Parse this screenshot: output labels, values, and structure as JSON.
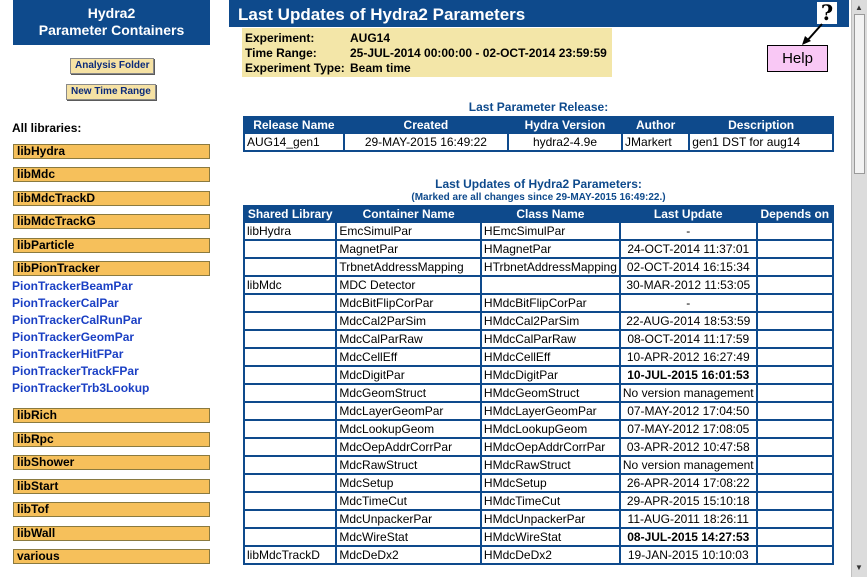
{
  "sidebar": {
    "title_line1": "Hydra2",
    "title_line2": "Parameter Containers",
    "analysis_folder_label": "Analysis Folder",
    "new_time_range_label": "New Time Range",
    "all_libraries_label": "All libraries:",
    "libs_top": [
      "libHydra",
      "libMdc",
      "libMdcTrackD",
      "libMdcTrackG",
      "libParticle",
      "libPionTracker"
    ],
    "pion_tracker_containers": [
      "PionTrackerBeamPar",
      "PionTrackerCalPar",
      "PionTrackerCalRunPar",
      "PionTrackerGeomPar",
      "PionTrackerHitFPar",
      "PionTrackerTrackFPar",
      "PionTrackerTrb3Lookup"
    ],
    "libs_bottom": [
      "libRich",
      "libRpc",
      "libShower",
      "libStart",
      "libTof",
      "libWall",
      "various"
    ]
  },
  "header": {
    "title": "Last Updates of Hydra2 Parameters",
    "help_glyph": "?"
  },
  "help_box": {
    "label": "Help"
  },
  "info": {
    "experiment_label": "Experiment:",
    "experiment_value": "AUG14",
    "time_range_label": "Time Range:",
    "time_range_value": "25-JUL-2014 00:00:00   -  02-OCT-2014 23:59:59",
    "experiment_type_label": "Experiment Type:",
    "experiment_type_value": "Beam time"
  },
  "release": {
    "caption": "Last Parameter Release:",
    "columns": [
      "Release Name",
      "Created",
      "Hydra Version",
      "Author",
      "Description"
    ],
    "row": [
      "AUG14_gen1",
      "29-MAY-2015 16:49:22",
      "hydra2-4.9e",
      "JMarkert",
      "gen1 DST for aug14"
    ]
  },
  "updates": {
    "caption": "Last Updates of Hydra2 Parameters:",
    "subcaption": "(Marked are all changes since 29-MAY-2015 16:49:22.)",
    "columns": [
      "Shared Library",
      "Container Name",
      "Class Name",
      "Last Update",
      "Depends on"
    ],
    "rows": [
      {
        "lib": "libHydra",
        "container": "EmcSimulPar",
        "class": "HEmcSimulPar",
        "update": "-",
        "depends": "",
        "changed": false
      },
      {
        "lib": "",
        "container": "MagnetPar",
        "class": "HMagnetPar",
        "update": "24-OCT-2014 11:37:01",
        "depends": "",
        "changed": false
      },
      {
        "lib": "",
        "container": "TrbnetAddressMapping",
        "class": "HTrbnetAddressMapping",
        "update": "02-OCT-2014 16:15:34",
        "depends": "",
        "changed": false
      },
      {
        "lib": "libMdc",
        "container": "MDC Detector",
        "class": "",
        "update": "30-MAR-2012 11:53:05",
        "depends": "",
        "changed": false
      },
      {
        "lib": "",
        "container": "MdcBitFlipCorPar",
        "class": "HMdcBitFlipCorPar",
        "update": "-",
        "depends": "",
        "changed": false
      },
      {
        "lib": "",
        "container": "MdcCal2ParSim",
        "class": "HMdcCal2ParSim",
        "update": "22-AUG-2014 18:53:59",
        "depends": "",
        "changed": false
      },
      {
        "lib": "",
        "container": "MdcCalParRaw",
        "class": "HMdcCalParRaw",
        "update": "08-OCT-2014 11:17:59",
        "depends": "",
        "changed": false
      },
      {
        "lib": "",
        "container": "MdcCellEff",
        "class": "HMdcCellEff",
        "update": "10-APR-2012 16:27:49",
        "depends": "",
        "changed": false
      },
      {
        "lib": "",
        "container": "MdcDigitPar",
        "class": "HMdcDigitPar",
        "update": "10-JUL-2015 16:01:53",
        "depends": "",
        "changed": true
      },
      {
        "lib": "",
        "container": "MdcGeomStruct",
        "class": "HMdcGeomStruct",
        "update": "No version management",
        "depends": "",
        "changed": false
      },
      {
        "lib": "",
        "container": "MdcLayerGeomPar",
        "class": "HMdcLayerGeomPar",
        "update": "07-MAY-2012 17:04:50",
        "depends": "",
        "changed": false
      },
      {
        "lib": "",
        "container": "MdcLookupGeom",
        "class": "HMdcLookupGeom",
        "update": "07-MAY-2012 17:08:05",
        "depends": "",
        "changed": false
      },
      {
        "lib": "",
        "container": "MdcOepAddrCorrPar",
        "class": "HMdcOepAddrCorrPar",
        "update": "03-APR-2012 10:47:58",
        "depends": "",
        "changed": false
      },
      {
        "lib": "",
        "container": "MdcRawStruct",
        "class": "HMdcRawStruct",
        "update": "No version management",
        "depends": "",
        "changed": false
      },
      {
        "lib": "",
        "container": "MdcSetup",
        "class": "HMdcSetup",
        "update": "26-APR-2014 17:08:22",
        "depends": "",
        "changed": false
      },
      {
        "lib": "",
        "container": "MdcTimeCut",
        "class": "HMdcTimeCut",
        "update": "29-APR-2015 15:10:18",
        "depends": "",
        "changed": false
      },
      {
        "lib": "",
        "container": "MdcUnpackerPar",
        "class": "HMdcUnpackerPar",
        "update": "11-AUG-2011 18:26:11",
        "depends": "",
        "changed": false
      },
      {
        "lib": "",
        "container": "MdcWireStat",
        "class": "HMdcWireStat",
        "update": "08-JUL-2015 14:27:53",
        "depends": "",
        "changed": true
      },
      {
        "lib": "libMdcTrackD",
        "container": "MdcDeDx2",
        "class": "HMdcDeDx2",
        "update": "19-JAN-2015 10:10:03",
        "depends": "",
        "changed": false
      }
    ]
  },
  "colors": {
    "header_blue": "#0e4a8c",
    "lib_button": "#f6c05b",
    "info_box": "#f3e6a8",
    "help_box": "#f9c8f5",
    "changed_red": "#c0101a",
    "link_blue": "#1a3fc4"
  }
}
